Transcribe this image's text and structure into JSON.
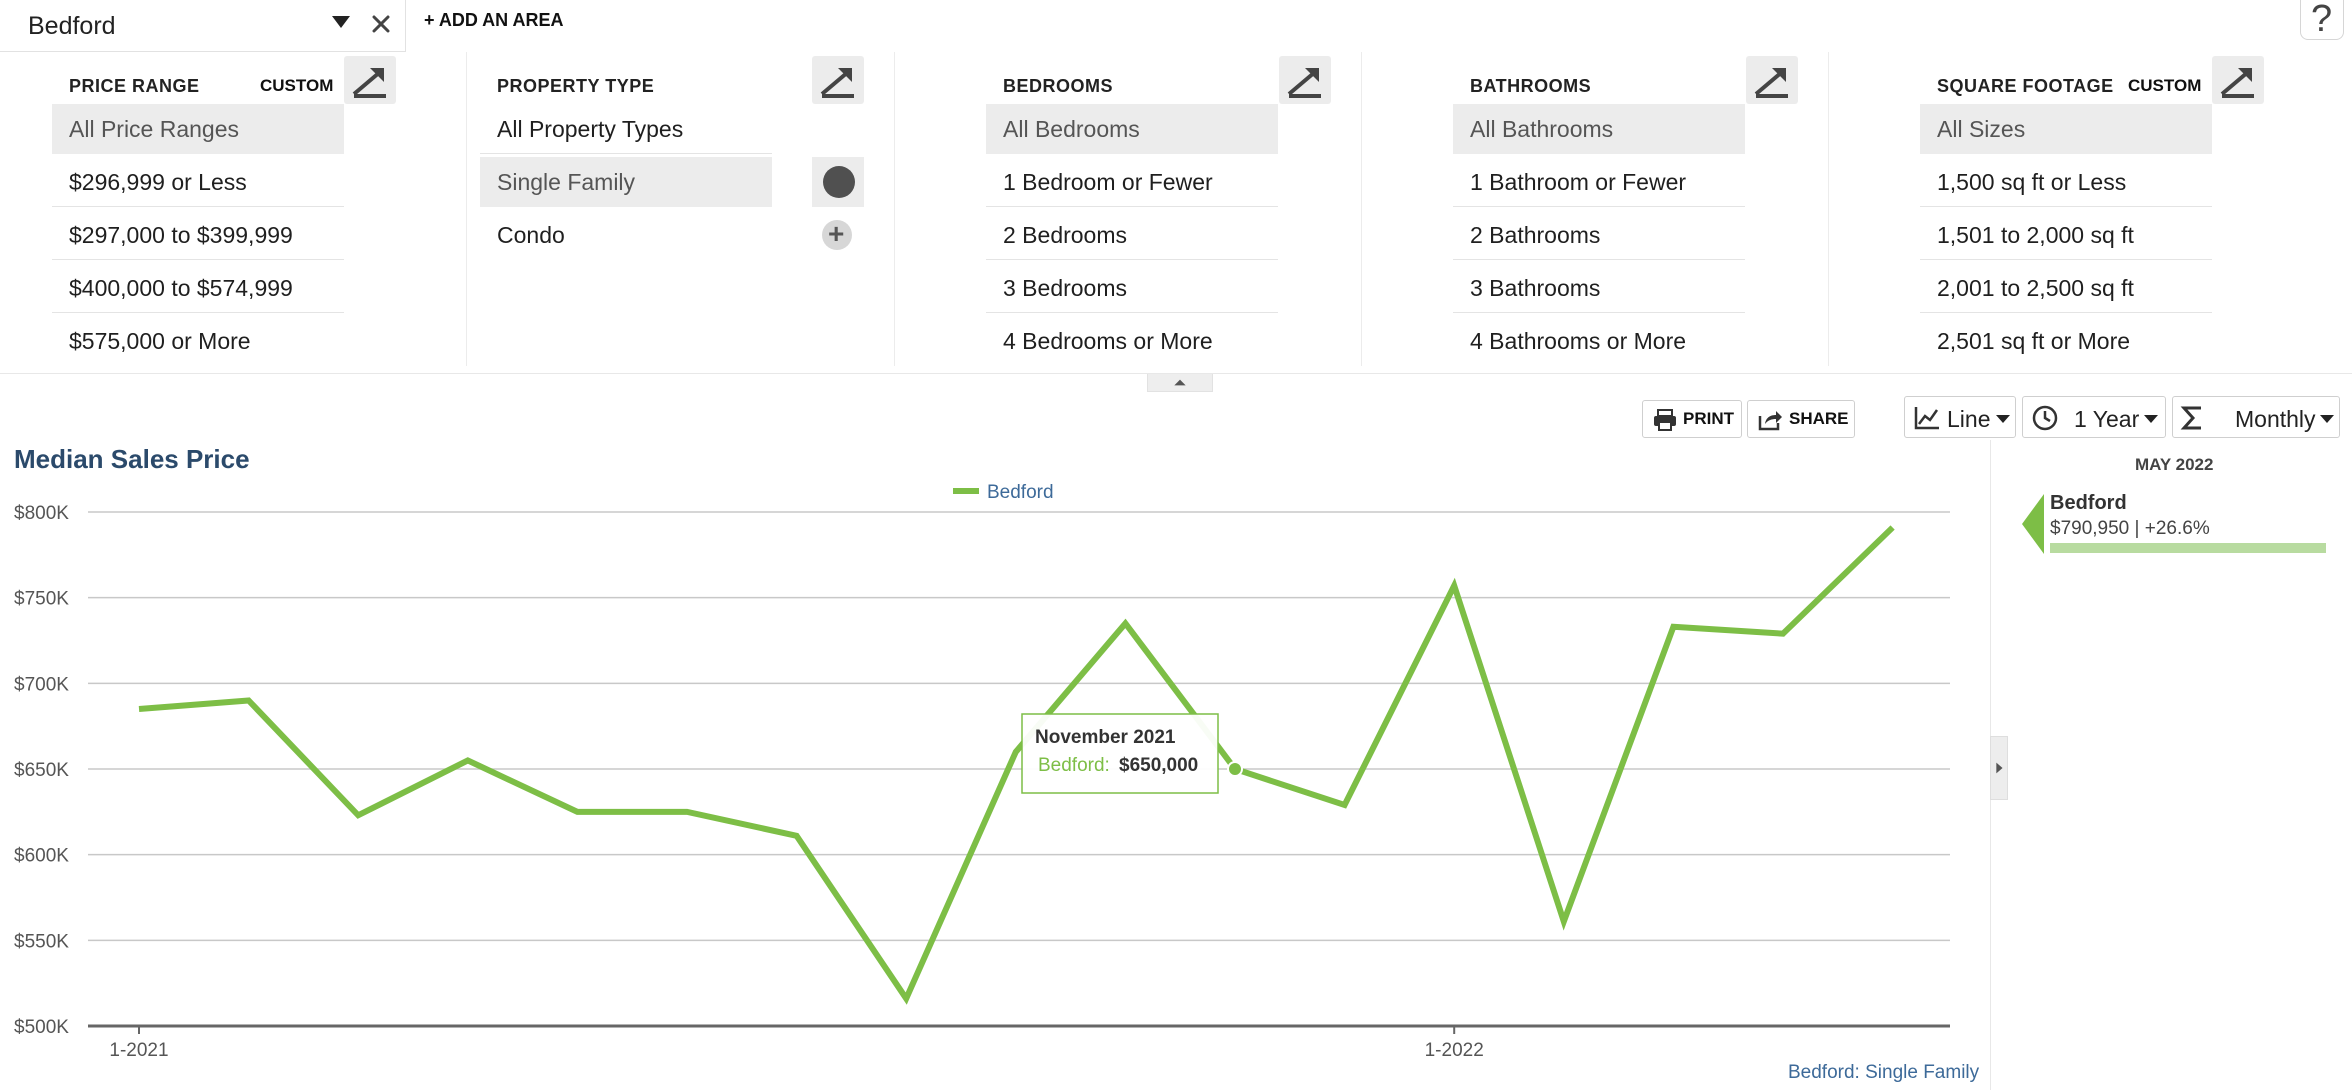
{
  "topbar": {
    "area_name": "Bedford",
    "add_area_label": "+ ADD AN AREA",
    "help_label": "?"
  },
  "filters": {
    "price_range": {
      "title": "PRICE RANGE",
      "custom_label": "CUSTOM",
      "options": [
        "All Price Ranges",
        "$296,999 or Less",
        "$297,000 to $399,999",
        "$400,000 to $574,999",
        "$575,000 or More"
      ],
      "selected": "All Price Ranges"
    },
    "property_type": {
      "title": "PROPERTY TYPE",
      "options": [
        "All Property Types",
        "Single Family",
        "Condo"
      ],
      "selected": "Single Family"
    },
    "bedrooms": {
      "title": "BEDROOMS",
      "options": [
        "All Bedrooms",
        "1 Bedroom or Fewer",
        "2 Bedrooms",
        "3 Bedrooms",
        "4 Bedrooms or More"
      ],
      "selected": "All Bedrooms"
    },
    "bathrooms": {
      "title": "BATHROOMS",
      "options": [
        "All Bathrooms",
        "1 Bathroom or Fewer",
        "2 Bathrooms",
        "3 Bathrooms",
        "4 Bathrooms or More"
      ],
      "selected": "All Bathrooms"
    },
    "square_footage": {
      "title": "SQUARE FOOTAGE",
      "custom_label": "CUSTOM",
      "options": [
        "All Sizes",
        "1,500 sq ft or Less",
        "1,501 to 2,000 sq ft",
        "2,001 to 2,500 sq ft",
        "2,501 sq ft or More"
      ],
      "selected": "All Sizes"
    }
  },
  "toolbar": {
    "print_label": "PRINT",
    "share_label": "SHARE",
    "chart_type": "Line",
    "time_range": "1 Year",
    "interval": "Monthly"
  },
  "chart_data": {
    "type": "line",
    "title": "Median Sales Price",
    "x": [
      "2021-01",
      "2021-02",
      "2021-03",
      "2021-04",
      "2021-05",
      "2021-06",
      "2021-07",
      "2021-08",
      "2021-09",
      "2021-10",
      "2021-11",
      "2021-12",
      "2022-01",
      "2022-02",
      "2022-03",
      "2022-04",
      "2022-05"
    ],
    "series": [
      {
        "name": "Bedford",
        "color": "#7dbe46",
        "values": [
          685000,
          690000,
          623000,
          655000,
          625000,
          625000,
          611000,
          516000,
          660000,
          735000,
          650000,
          629000,
          757000,
          561000,
          733000,
          729000,
          790950
        ]
      }
    ],
    "xticks": [
      {
        "x": "2021-01",
        "label": "1-2021"
      },
      {
        "x": "2022-01",
        "label": "1-2022"
      }
    ],
    "yticks": [
      "$500K",
      "$550K",
      "$600K",
      "$650K",
      "$700K",
      "$750K",
      "$800K"
    ],
    "ylim": [
      500000,
      800000
    ],
    "grid": true,
    "legend": "top-center",
    "tooltip": {
      "title": "November 2021",
      "series": "Bedford:",
      "value": "$650,000",
      "x": "2021-11"
    }
  },
  "side_panel": {
    "date": "MAY 2022",
    "series": "Bedford",
    "value": "$790,950 | +26.6%",
    "bar_color": "#b8dba0"
  },
  "footnote": "Bedford: Single Family"
}
